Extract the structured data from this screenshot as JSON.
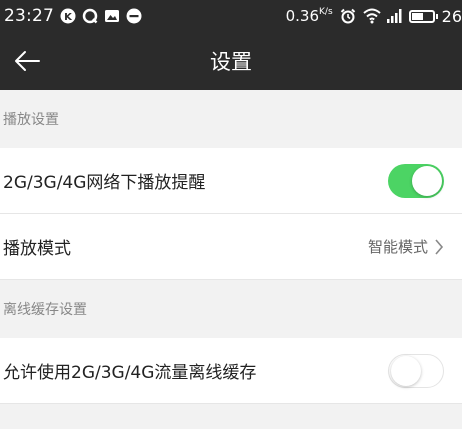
{
  "status_bar": {
    "time": "23:27",
    "speed": "0.36",
    "speed_unit": "K/s",
    "battery": "26"
  },
  "header": {
    "title": "设置"
  },
  "sections": [
    {
      "title": "播放设置",
      "rows": [
        {
          "label": "2G/3G/4G网络下播放提醒",
          "toggle": true
        },
        {
          "label": "播放模式",
          "value": "智能模式"
        }
      ]
    },
    {
      "title": "离线缓存设置",
      "rows": [
        {
          "label": "允许使用2G/3G/4G流量离线缓存",
          "toggle": false
        }
      ]
    }
  ],
  "colors": {
    "toggle_on": "#4cd464",
    "header_bg": "#2b2b2b"
  }
}
